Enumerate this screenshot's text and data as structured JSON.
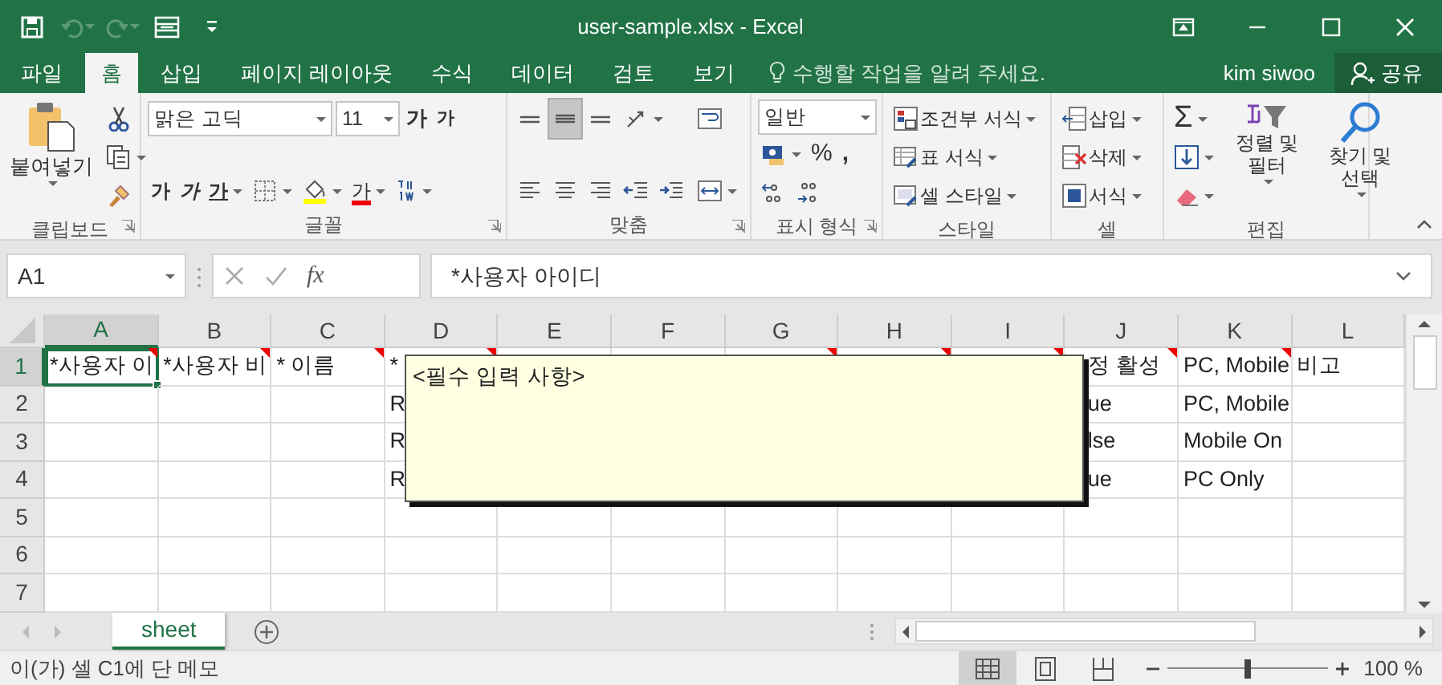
{
  "title_bar": {
    "title": "user-sample.xlsx - Excel",
    "quick_access": [
      {
        "kind": "save",
        "disabled": false
      },
      {
        "kind": "undo",
        "disabled": true
      },
      {
        "kind": "redo",
        "disabled": true
      },
      {
        "kind": "form",
        "disabled": false
      },
      {
        "kind": "customize",
        "disabled": false
      }
    ],
    "window_controls": [
      {
        "kind": "ribbon-options"
      },
      {
        "kind": "minimize"
      },
      {
        "kind": "maximize"
      },
      {
        "kind": "close"
      }
    ]
  },
  "tabs": [
    {
      "label": "파일",
      "selected": false
    },
    {
      "label": "홈",
      "selected": true
    },
    {
      "label": "삽입",
      "selected": false
    },
    {
      "label": "페이지 레이아웃",
      "selected": false
    },
    {
      "label": "수식",
      "selected": false
    },
    {
      "label": "데이터",
      "selected": false
    },
    {
      "label": "검토",
      "selected": false
    },
    {
      "label": "보기",
      "selected": false
    }
  ],
  "tell_me": {
    "placeholder": "수행할 작업을 알려 주세요."
  },
  "user": "kim siwoo",
  "share": "공유",
  "ribbon": {
    "groups": [
      {
        "label": "클립보드",
        "launcher": true,
        "columns": [
          [
            [
              {
                "kind": "paste",
                "label": "붙여넣기"
              }
            ]
          ],
          [
            [
              {
                "kind": "cut"
              }
            ],
            [
              {
                "kind": "copy"
              }
            ],
            [
              {
                "kind": "painter"
              }
            ]
          ]
        ]
      },
      {
        "label": "글꼴",
        "launcher": true,
        "columns": [
          [
            [
              {
                "kind": "font",
                "label": "맑은 고딕"
              },
              {
                "kind": "size",
                "label": "11"
              },
              {
                "kind": "grow",
                "label": "가"
              },
              {
                "kind": "shrink",
                "label": "가"
              }
            ],
            [
              {
                "kind": "bold",
                "label": "가"
              },
              {
                "kind": "italic",
                "label": "가"
              },
              {
                "kind": "underline",
                "label": "가"
              },
              {
                "kind": "border"
              },
              {
                "kind": "fill"
              },
              {
                "kind": "fontcolor",
                "label": "가"
              },
              {
                "kind": "phonetic"
              }
            ]
          ]
        ]
      },
      {
        "label": "맞춤",
        "launcher": true,
        "columns": [
          [
            [
              {
                "kind": "top",
                "pressed": false
              },
              {
                "kind": "middle",
                "pressed": true
              },
              {
                "kind": "bottom",
                "pressed": false
              },
              {
                "kind": "orient",
                "pressed": false
              }
            ],
            [
              {
                "kind": "left",
                "pressed": false
              },
              {
                "kind": "center",
                "pressed": false
              },
              {
                "kind": "right",
                "pressed": false
              },
              {
                "kind": "outdent",
                "pressed": false
              },
              {
                "kind": "indent",
                "pressed": false
              }
            ]
          ],
          [
            [
              {
                "kind": "wrap",
                "pressed": false
              }
            ],
            [
              {
                "kind": "merge",
                "pressed": false
              }
            ]
          ]
        ]
      },
      {
        "label": "표시 형식",
        "launcher": true,
        "columns": [
          [
            [
              {
                "kind": "numfmt",
                "label": "일반"
              }
            ],
            [
              {
                "kind": "currency"
              },
              {
                "kind": "percent",
                "label": "%"
              },
              {
                "kind": "comma",
                "label": ","
              }
            ],
            [
              {
                "kind": "incdec"
              },
              {
                "kind": "decdec"
              }
            ]
          ]
        ]
      },
      {
        "label": "스타일",
        "launcher": false,
        "columns": [
          [
            [
              {
                "kind": "cond",
                "label": "조건부 서식"
              }
            ],
            [
              {
                "kind": "table",
                "label": "표 서식"
              }
            ],
            [
              {
                "kind": "cellstyle",
                "label": "셀 스타일"
              }
            ]
          ]
        ]
      },
      {
        "label": "셀",
        "launcher": false,
        "columns": [
          [
            [
              {
                "kind": "insert",
                "label": "삽입"
              }
            ],
            [
              {
                "kind": "delete",
                "label": "삭제"
              }
            ],
            [
              {
                "kind": "format",
                "label": "서식"
              }
            ]
          ]
        ]
      },
      {
        "label": "편집",
        "launcher": false,
        "columns": [
          [
            [
              {
                "kind": "sum",
                "label": "Σ"
              }
            ],
            [
              {
                "kind": "filldown"
              }
            ],
            [
              {
                "kind": "clear"
              }
            ]
          ],
          [
            [
              {
                "kind": "sort",
                "label": "정렬 및 필터"
              }
            ]
          ],
          [
            [
              {
                "kind": "find",
                "label": "찾기 및 선택"
              }
            ]
          ]
        ]
      }
    ]
  },
  "formula_bar": {
    "name_box": "A1",
    "function_label": "fx",
    "formula": "*사용자 아이디"
  },
  "sheet": {
    "columns": [
      {
        "label": "A",
        "selected": true
      },
      {
        "label": "B",
        "selected": false
      },
      {
        "label": "C",
        "selected": false
      },
      {
        "label": "D",
        "selected": false
      },
      {
        "label": "E",
        "selected": false
      },
      {
        "label": "F",
        "selected": false
      },
      {
        "label": "G",
        "selected": false
      },
      {
        "label": "H",
        "selected": false
      },
      {
        "label": "I",
        "selected": false
      },
      {
        "label": "J",
        "selected": false
      },
      {
        "label": "K",
        "selected": false
      },
      {
        "label": "L",
        "selected": false
      }
    ],
    "rows": [
      {
        "header": "1",
        "selected": true,
        "cells": [
          {
            "text": "*사용자 이",
            "selected": true,
            "comment": true
          },
          {
            "text": "*사용자 비",
            "selected": false,
            "comment": true
          },
          {
            "text": "* 이름",
            "selected": false,
            "comment": true
          },
          {
            "text": "*",
            "selected": false,
            "comment": true
          },
          {
            "selected": false,
            "comment": false
          },
          {
            "selected": false,
            "comment": false
          },
          {
            "selected": false,
            "comment": true
          },
          {
            "selected": false,
            "comment": true
          },
          {
            "selected": false,
            "comment": true
          },
          {
            "text": "정 활성",
            "selected": false,
            "comment": true
          },
          {
            "text": "PC, Mobile",
            "selected": false,
            "comment": true
          },
          {
            "text": "비고",
            "selected": false,
            "comment": false
          }
        ]
      },
      {
        "header": "2",
        "selected": false,
        "cells": [
          {
            "selected": false,
            "comment": false
          },
          {
            "selected": false,
            "comment": false
          },
          {
            "selected": false,
            "comment": false
          },
          {
            "text": "R",
            "selected": false
          },
          null,
          null,
          null,
          null,
          null,
          {
            "text": "ue",
            "selected": false,
            "comment": false
          },
          {
            "text": "PC, Mobile",
            "selected": false,
            "comment": false
          },
          {
            "selected": false,
            "comment": false
          }
        ]
      },
      {
        "header": "3",
        "selected": false,
        "cells": [
          {
            "selected": false,
            "comment": false
          },
          {
            "selected": false,
            "comment": false
          },
          {
            "selected": false,
            "comment": false
          },
          {
            "text": "R",
            "selected": false
          },
          null,
          null,
          null,
          null,
          null,
          {
            "text": "lse",
            "selected": false,
            "comment": false
          },
          {
            "text": "Mobile On",
            "selected": false,
            "comment": false
          },
          {
            "selected": false,
            "comment": false
          }
        ]
      },
      {
        "header": "4",
        "selected": false,
        "cells": [
          {
            "selected": false,
            "comment": false
          },
          {
            "selected": false,
            "comment": false
          },
          {
            "selected": false,
            "comment": false
          },
          {
            "text": "R",
            "selected": false
          },
          null,
          null,
          null,
          null,
          null,
          {
            "text": "ue",
            "selected": false,
            "comment": false
          },
          {
            "text": "PC Only",
            "selected": false,
            "comment": false
          },
          {
            "selected": false,
            "comment": false
          }
        ]
      },
      {
        "header": "5",
        "selected": false,
        "cells": [
          {
            "selected": false,
            "comment": false
          },
          {
            "selected": false,
            "comment": false
          },
          {
            "selected": false,
            "comment": false
          },
          {
            "selected": false,
            "comment": false
          },
          {
            "selected": false,
            "comment": false
          },
          {
            "selected": false,
            "comment": false
          },
          {
            "selected": false,
            "comment": false
          },
          {
            "selected": false,
            "comment": false
          },
          {
            "selected": false,
            "comment": false
          },
          {
            "selected": false,
            "comment": false
          },
          {
            "selected": false,
            "comment": false
          },
          {
            "selected": false,
            "comment": false
          }
        ]
      },
      {
        "header": "6",
        "selected": false,
        "cells": [
          {
            "selected": false,
            "comment": false
          },
          {
            "selected": false,
            "comment": false
          },
          {
            "selected": false,
            "comment": false
          },
          {
            "selected": false,
            "comment": false
          },
          {
            "selected": false,
            "comment": false
          },
          {
            "selected": false,
            "comment": false
          },
          {
            "selected": false,
            "comment": false
          },
          {
            "selected": false,
            "comment": false
          },
          {
            "selected": false,
            "comment": false
          },
          {
            "selected": false,
            "comment": false
          },
          {
            "selected": false,
            "comment": false
          },
          {
            "selected": false,
            "comment": false
          }
        ]
      },
      {
        "header": "7",
        "selected": false,
        "cells": [
          {
            "selected": false,
            "comment": false
          },
          {
            "selected": false,
            "comment": false
          },
          {
            "selected": false,
            "comment": false
          },
          {
            "selected": false,
            "comment": false
          },
          {
            "selected": false,
            "comment": false
          },
          {
            "selected": false,
            "comment": false
          },
          {
            "selected": false,
            "comment": false
          },
          {
            "selected": false,
            "comment": false
          },
          {
            "selected": false,
            "comment": false
          },
          {
            "selected": false,
            "comment": false
          },
          {
            "selected": false,
            "comment": false
          },
          {
            "selected": false,
            "comment": false
          }
        ]
      }
    ],
    "comment_popup": {
      "text": "<필수 입력 사항>"
    }
  },
  "sheet_tabs": [
    {
      "label": "sheet",
      "selected": true
    }
  ],
  "status_bar": {
    "message": "이(가) 셀 C1에 단 메모",
    "views": [
      {
        "kind": "normal",
        "selected": true
      },
      {
        "kind": "layout",
        "selected": false
      },
      {
        "kind": "pagebreak",
        "selected": false
      }
    ],
    "zoom": {
      "level": 0.5,
      "reading": "100 %"
    }
  }
}
